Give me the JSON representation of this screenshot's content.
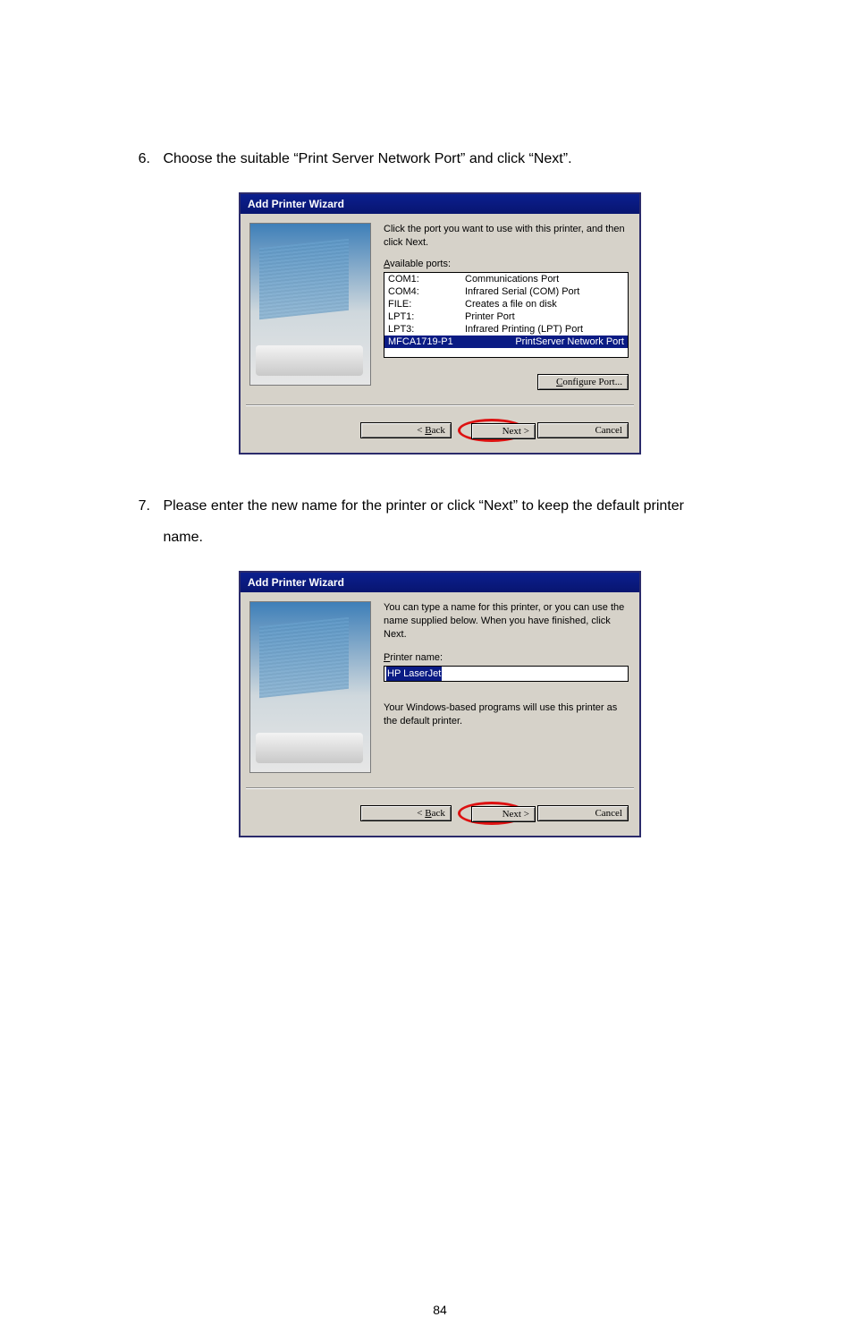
{
  "steps": {
    "s6_num": "6.",
    "s6_text": "Choose the suitable “Print Server Network Port” and click “Next”.",
    "s7_num": "7.",
    "s7_text": "Please enter the new name for the printer or click “Next” to keep the default printer name."
  },
  "dialog1": {
    "title": "Add Printer Wizard",
    "instruction": "Click the port you want to use with this printer, and then click Next.",
    "ports_label_pre": "A",
    "ports_label_rest": "vailable ports:",
    "rows": [
      {
        "name": "COM1:",
        "desc": "Communications Port"
      },
      {
        "name": "COM4:",
        "desc": "Infrared Serial (COM) Port"
      },
      {
        "name": "FILE:",
        "desc": "Creates a file on disk"
      },
      {
        "name": "LPT1:",
        "desc": "Printer Port"
      },
      {
        "name": "LPT3:",
        "desc": "Infrared Printing (LPT) Port"
      },
      {
        "name": "MFCA1719-P1",
        "desc": "PrintServer Network Port"
      }
    ],
    "configure_pre": "C",
    "configure_rest": "onfigure Port...",
    "back_pre": "< ",
    "back_u": "B",
    "back_rest": "ack",
    "next": "Next >",
    "cancel": "Cancel"
  },
  "dialog2": {
    "title": "Add Printer Wizard",
    "instruction": "You can type a name for this printer, or you can use the name supplied below. When you have finished, click Next.",
    "name_label_pre": "P",
    "name_label_rest": "rinter name:",
    "name_value": "HP LaserJet",
    "note": "Your Windows-based programs will use this printer as the default printer.",
    "back_pre": "< ",
    "back_u": "B",
    "back_rest": "ack",
    "next": "Next >",
    "cancel": "Cancel"
  },
  "page_number": "84"
}
